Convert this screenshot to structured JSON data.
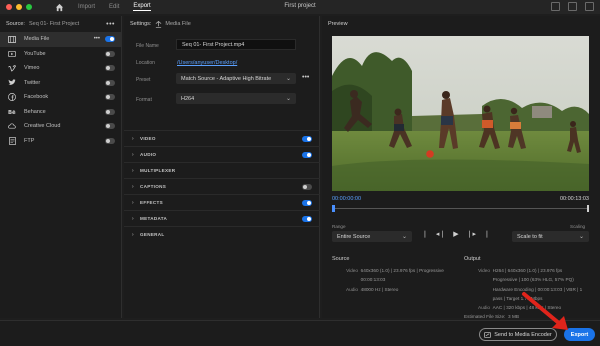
{
  "titlebar": {
    "nav": [
      "Import",
      "Edit",
      "Export"
    ],
    "active_tab": "Export",
    "project_title": "First project"
  },
  "source": {
    "label": "Source:",
    "project": "Seq 01- First Project",
    "more": "•••",
    "destinations": [
      {
        "label": "Media File",
        "icon": "film-icon",
        "enabled": true,
        "selected": true
      },
      {
        "label": "YouTube",
        "icon": "youtube-icon",
        "enabled": false
      },
      {
        "label": "Vimeo",
        "icon": "vimeo-icon",
        "enabled": false
      },
      {
        "label": "Twitter",
        "icon": "twitter-icon",
        "enabled": false
      },
      {
        "label": "Facebook",
        "icon": "facebook-icon",
        "enabled": false
      },
      {
        "label": "Behance",
        "icon": "behance-icon",
        "enabled": false
      },
      {
        "label": "Creative Cloud",
        "icon": "creative-cloud-icon",
        "enabled": false
      },
      {
        "label": "FTP",
        "icon": "ftp-icon",
        "enabled": false
      }
    ]
  },
  "settings": {
    "label": "Settings:",
    "target": "Media File",
    "file_name_label": "File Name",
    "file_name_value": "Seq 01- First Project.mp4",
    "location_label": "Location",
    "location_value": "/Users/anyuser/Desktop/",
    "preset_label": "Preset",
    "preset_value": "Match Source - Adaptive High Bitrate",
    "format_label": "Format",
    "format_value": "H264",
    "sections": [
      {
        "label": "VIDEO",
        "toggle": true,
        "on": true
      },
      {
        "label": "AUDIO",
        "toggle": true,
        "on": true
      },
      {
        "label": "MULTIPLEXER",
        "toggle": false
      },
      {
        "label": "CAPTIONS",
        "toggle": true,
        "on": false
      },
      {
        "label": "EFFECTS",
        "toggle": true,
        "on": true
      },
      {
        "label": "METADATA",
        "toggle": true,
        "on": true
      },
      {
        "label": "GENERAL",
        "toggle": false
      }
    ]
  },
  "preview": {
    "label": "Preview",
    "tc_start": "00:00:00:00",
    "tc_end": "00:00:13:03",
    "range_label": "Range",
    "range_value": "Entire Source",
    "scaling_label": "Scaling",
    "scaling_value": "Scale to fit",
    "source_title": "Source",
    "output_title": "Output",
    "source_video_label": "Video",
    "source_video": [
      "640x360 (1.0)  |  23.976 fps  |  Progressive",
      "00:00:13:03"
    ],
    "source_audio_label": "Audio",
    "source_audio": "48000 Hz  |  Stereo",
    "output_video_label": "Video",
    "output_video": [
      "H264  |  640x360 (1.0)  |  23.976 fps",
      "Progressive  |  100 (63% HLG, 57% PQ)",
      "Hardware Encoding  |  00:00:13:03  |  VBR  |  1",
      "pass  |  Target 1.70 Mbps"
    ],
    "output_audio_label": "Audio",
    "output_audio": "AAC  |  320 kbps  |  48 kHz  |  Stereo",
    "estimated_label": "Estimated File Size:",
    "estimated_value": "3 MB"
  },
  "footer": {
    "ame_label": "Send to Media Encoder",
    "export_label": "Export"
  },
  "colors": {
    "accent": "#1a73e8",
    "link": "#5aa0ff",
    "annotation": "#e0241b"
  }
}
